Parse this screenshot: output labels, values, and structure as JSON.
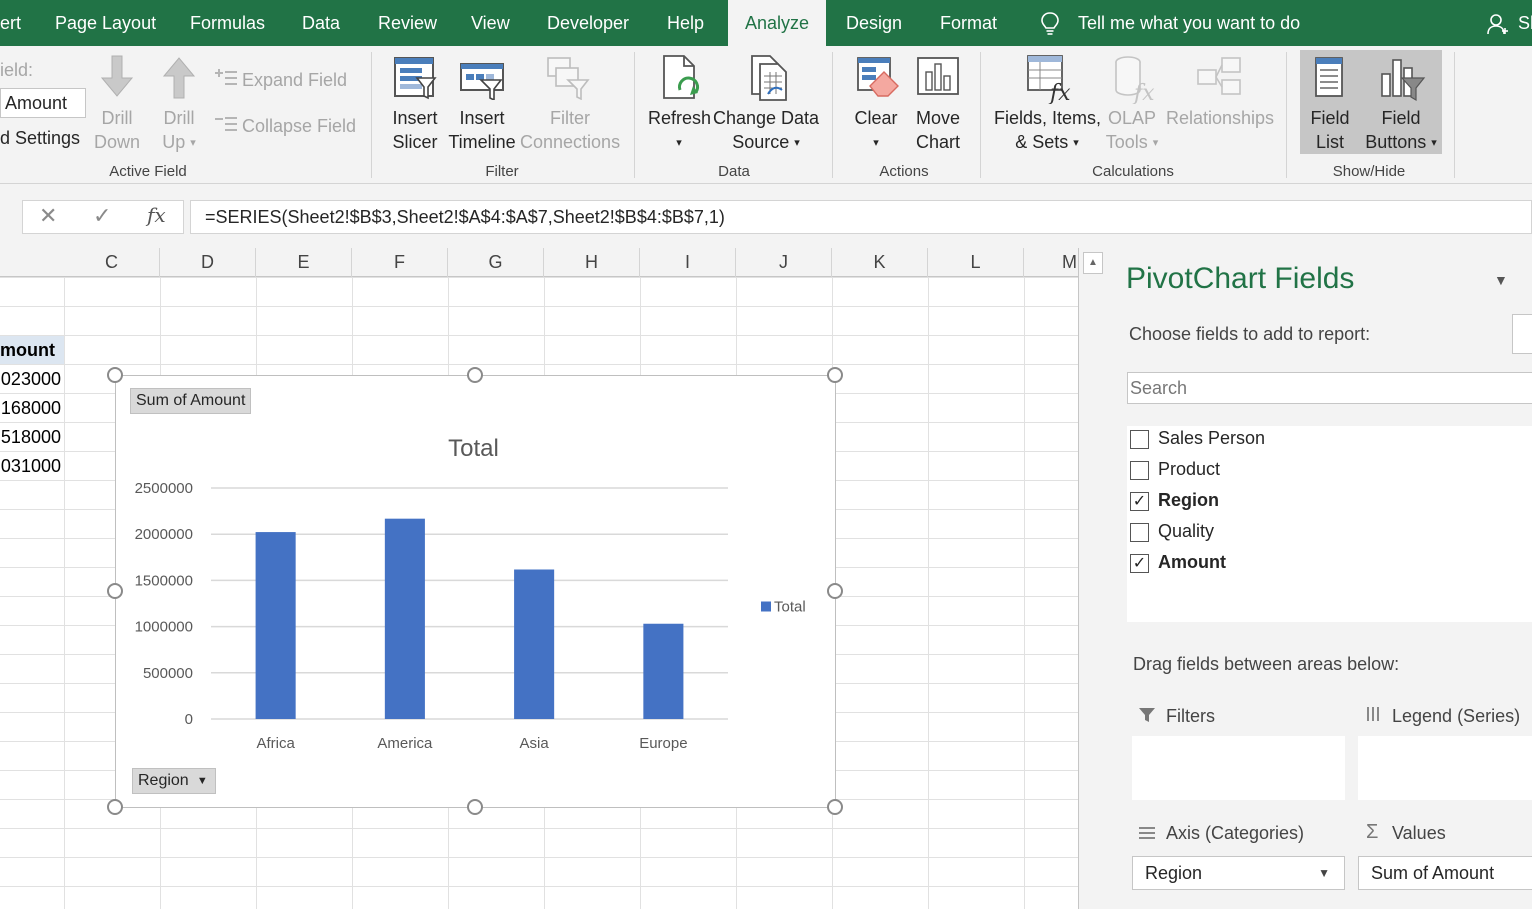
{
  "tabs": [
    {
      "label": "ert",
      "active": false
    },
    {
      "label": "Page Layout",
      "active": false
    },
    {
      "label": "Formulas",
      "active": false
    },
    {
      "label": "Data",
      "active": false
    },
    {
      "label": "Review",
      "active": false
    },
    {
      "label": "View",
      "active": false
    },
    {
      "label": "Developer",
      "active": false
    },
    {
      "label": "Help",
      "active": false
    },
    {
      "label": "Analyze",
      "active": true
    },
    {
      "label": "Design",
      "active": false
    },
    {
      "label": "Format",
      "active": false
    }
  ],
  "tell_me": "Tell me what you want to do",
  "share_label": "Sh",
  "ribbon": {
    "active_field": {
      "field_label": "ield:",
      "field_value": "Amount",
      "settings_label": "d Settings",
      "drill_down": [
        "Drill",
        "Down"
      ],
      "drill_up": [
        "Drill",
        "Up"
      ],
      "expand_field": "Expand Field",
      "collapse_field": "Collapse Field",
      "group": "Active Field"
    },
    "filter": {
      "insert_slicer": [
        "Insert",
        "Slicer"
      ],
      "insert_timeline": [
        "Insert",
        "Timeline"
      ],
      "filter_connections": [
        "Filter",
        "Connections"
      ],
      "group": "Filter"
    },
    "data": {
      "refresh": [
        "Refresh",
        ""
      ],
      "change_source": [
        "Change Data",
        "Source"
      ],
      "group": "Data"
    },
    "actions": {
      "clear": [
        "Clear",
        ""
      ],
      "move_chart": [
        "Move",
        "Chart"
      ],
      "group": "Actions"
    },
    "calculations": {
      "fields_items": [
        "Fields, Items,",
        "& Sets"
      ],
      "olap_tools": [
        "OLAP",
        "Tools"
      ],
      "relationships": "Relationships",
      "group": "Calculations"
    },
    "show_hide": {
      "field_list": [
        "Field",
        "List"
      ],
      "field_buttons": [
        "Field",
        "Buttons"
      ],
      "group": "Show/Hide"
    }
  },
  "formula_bar": {
    "cancel": "✕",
    "enter": "✓",
    "fx": "fx",
    "formula": "=SERIES(Sheet2!$B$3,Sheet2!$A$4:$A$7,Sheet2!$B$4:$B$7,1)"
  },
  "columns": [
    "C",
    "D",
    "E",
    "F",
    "G",
    "H",
    "I",
    "J",
    "K",
    "L",
    "M"
  ],
  "sheet_cells": {
    "header": "mount",
    "values": [
      "023000",
      "168000",
      "518000",
      "031000"
    ]
  },
  "chart": {
    "field_button_values": "Sum of Amount",
    "field_button_axis": "Region"
  },
  "chart_data": {
    "type": "bar",
    "title": "Total",
    "categories": [
      "Africa",
      "America",
      "Asia",
      "Europe"
    ],
    "series": [
      {
        "name": "Total",
        "values": [
          2023000,
          2168000,
          1618000,
          1031000
        ]
      }
    ],
    "yticks": [
      "0",
      "500000",
      "1000000",
      "1500000",
      "2000000",
      "2500000"
    ],
    "ylim": [
      0,
      2500000
    ],
    "grid": true,
    "legend": "right",
    "color": "#4472c4"
  },
  "pane": {
    "title": "PivotChart Fields",
    "choose_label": "Choose fields to add to report:",
    "search_placeholder": "Search",
    "fields": [
      {
        "label": "Sales Person",
        "checked": false
      },
      {
        "label": "Product",
        "checked": false
      },
      {
        "label": "Region",
        "checked": true
      },
      {
        "label": "Quality",
        "checked": false
      },
      {
        "label": "Amount",
        "checked": true
      }
    ],
    "drag_label": "Drag fields between areas below:",
    "areas": {
      "filters": "Filters",
      "legend": "Legend (Series)",
      "axis": "Axis (Categories)",
      "values": "Values",
      "axis_item": "Region",
      "values_item": "Sum of Amount"
    }
  },
  "colors": {
    "excel_green": "#217346",
    "bar_blue": "#4472c4",
    "ribbon_bg": "#f3f3f3"
  }
}
